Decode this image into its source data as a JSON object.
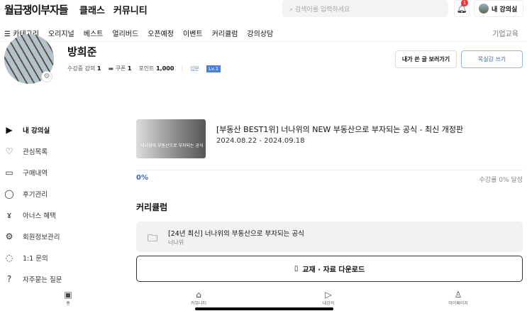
{
  "header": {
    "logo": "월급쟁이부자들",
    "nav": [
      "클래스",
      "커뮤니티"
    ],
    "search_placeholder": "검색어를 입력하세요",
    "notification_count": "1",
    "my_classroom": "내 강의실"
  },
  "category_nav": {
    "items": [
      "☰ 카테고리",
      "오리지널",
      "베스트",
      "얼리버드",
      "오픈예정",
      "이벤트",
      "커리큘럼",
      "강의상담"
    ],
    "corporate": "기업교육"
  },
  "profile": {
    "name": "방희준",
    "enrolled_label": "수강중 강의",
    "enrolled": "1",
    "coupon_label": "쿠폰",
    "coupon": "1",
    "points_label": "포인트",
    "points": "1,000",
    "tier": "입문",
    "level": "Lv.1",
    "my_posts_button": "내가 쓴 글 보러가기",
    "write_button": "목실감 쓰기"
  },
  "sidebar": {
    "items": [
      {
        "label": "내 강의실",
        "icon": "play-circle-icon",
        "glyph": "▶"
      },
      {
        "label": "관심목록",
        "icon": "heart-icon",
        "glyph": "♡"
      },
      {
        "label": "구매내역",
        "icon": "wallet-icon",
        "glyph": "▭"
      },
      {
        "label": "후기관리",
        "icon": "chat-bubble-icon",
        "glyph": "◯"
      },
      {
        "label": "아너스 혜택",
        "icon": "medal-icon",
        "glyph": "ɤ"
      },
      {
        "label": "회원정보관리",
        "icon": "gear-icon",
        "glyph": "⚙"
      },
      {
        "label": "1:1 문의",
        "icon": "chat-icon",
        "glyph": "◌"
      },
      {
        "label": "자주묻는 질문",
        "icon": "question-icon",
        "glyph": "?"
      }
    ]
  },
  "course": {
    "thumbnail_text": "너나위의 부동산으로 부자되는 공식",
    "title": "[부동산 BEST1위] 너나위의 NEW 부동산으로 부자되는 공식 - 최신 개정판",
    "dates": "2024.08.22 - 2024.09.18",
    "progress": "0%",
    "progress_text": "수강률 0% 달성"
  },
  "curriculum": {
    "heading": "커리큘럼",
    "item_title": "[24년 최신] 너나위의 부동산으로 부자되는 공식",
    "item_author": "너나위",
    "download": "교재 · 자료 다운로드"
  },
  "tabbar": [
    "홈",
    "커뮤니티",
    "내강의",
    "마이페이지"
  ]
}
